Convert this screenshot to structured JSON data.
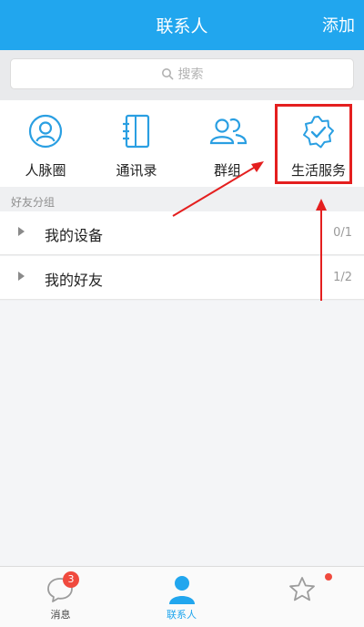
{
  "header": {
    "title": "联系人",
    "add_label": "添加"
  },
  "search": {
    "placeholder": "搜索"
  },
  "shortcuts": [
    {
      "label": "人脉圈",
      "icon": "person-circle-icon"
    },
    {
      "label": "通讯录",
      "icon": "address-book-icon"
    },
    {
      "label": "群组",
      "icon": "group-icon"
    },
    {
      "label": "生活服务",
      "icon": "verified-badge-icon"
    }
  ],
  "section": {
    "label": "好友分组"
  },
  "groups": [
    {
      "name": "我的设备",
      "count": "0/1"
    },
    {
      "name": "我的好友",
      "count": "1/2"
    }
  ],
  "tabbar": {
    "messages": {
      "label": "消息",
      "badge": "3"
    },
    "contacts": {
      "label": "联系人"
    }
  },
  "colors": {
    "brand": "#21a6ee",
    "icon_accent": "#2a9fe2",
    "highlight": "#e41f1f",
    "badge": "#f04a3e"
  }
}
